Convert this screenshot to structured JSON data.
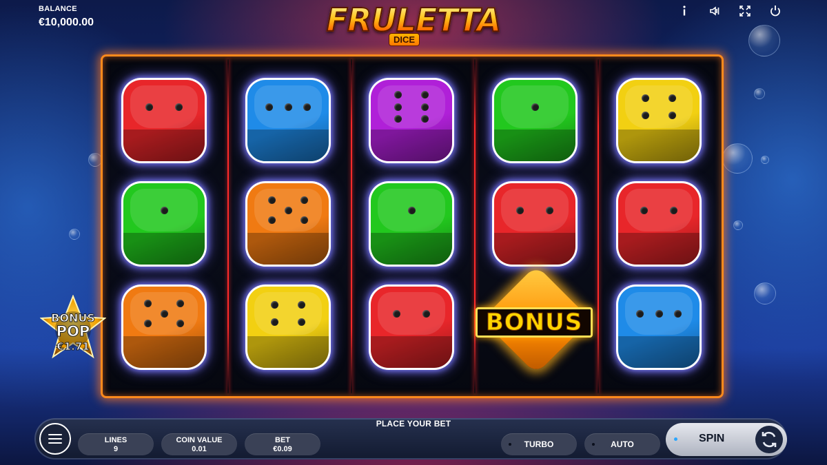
{
  "header": {
    "balance_label": "BALANCE",
    "balance_value": "€10,000.00",
    "logo_main": "FRULETTA",
    "logo_sub": "DICE",
    "icons": [
      "info-icon",
      "sound-icon",
      "fullscreen-icon",
      "power-icon"
    ]
  },
  "reels": {
    "grid": [
      [
        {
          "color": "#e8262a",
          "pips": 2
        },
        {
          "color": "#1f8be8",
          "pips": 3
        },
        {
          "color": "#b020d8",
          "pips": 6
        },
        {
          "color": "#22c81e",
          "pips": 1
        },
        {
          "color": "#f2d012",
          "pips": 4
        }
      ],
      [
        {
          "color": "#22c81e",
          "pips": 1
        },
        {
          "color": "#f07a12",
          "pips": 5
        },
        {
          "color": "#22c81e",
          "pips": 1
        },
        {
          "color": "#e8262a",
          "pips": 2
        },
        {
          "color": "#e8262a",
          "pips": 2
        }
      ],
      [
        {
          "color": "#f07a12",
          "pips": 5
        },
        {
          "color": "#f2d012",
          "pips": 4
        },
        {
          "color": "#e8262a",
          "pips": 2
        },
        {
          "color": "bonus",
          "pips": 0
        },
        {
          "color": "#1f8be8",
          "pips": 3
        }
      ]
    ],
    "bonus_label": "BONUS"
  },
  "bonus_pop": {
    "line1": "BONUS",
    "line2": "POP",
    "amount": "€1.71"
  },
  "footer": {
    "message": "PLACE YOUR BET",
    "lines_label": "LINES",
    "lines_value": "9",
    "coin_label": "COIN VALUE",
    "coin_value": "0.01",
    "bet_label": "BET",
    "bet_value": "€0.09",
    "turbo_label": "TURBO",
    "auto_label": "AUTO",
    "spin_label": "SPIN"
  },
  "colors": {
    "frame": "#ff8a1c",
    "separator": "#ff2a2a",
    "glow": "#7a7aff"
  }
}
